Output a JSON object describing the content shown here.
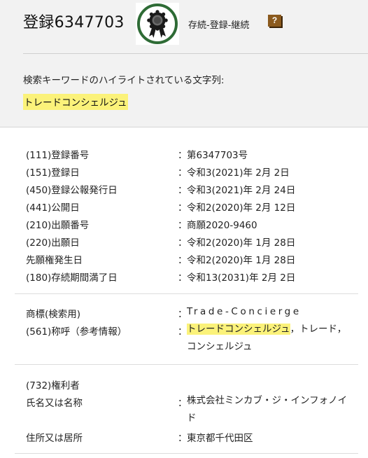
{
  "header": {
    "registration_title": "登録6347703",
    "status": "存続-登録-継続",
    "help_label": "?",
    "badge_icon": "award-ribbon-icon",
    "keyword_label": "検索キーワードのハイライトされている文字列:",
    "keyword": "トレードコンシェルジュ"
  },
  "colon": "：",
  "bibliographic": [
    {
      "label": "(111)登録番号",
      "value": "第6347703号"
    },
    {
      "label": "(151)登録日",
      "value": "令和3(2021)年 2月 2日"
    },
    {
      "label": "(450)登録公報発行日",
      "value": "令和3(2021)年 2月 24日"
    },
    {
      "label": "(441)公開日",
      "value": "令和2(2020)年 2月 12日"
    },
    {
      "label": "(210)出願番号",
      "value": "商願2020-9460"
    },
    {
      "label": "(220)出願日",
      "value": "令和2(2020)年 1月 28日"
    },
    {
      "label": "先願権発生日",
      "value": "令和2(2020)年 1月 28日"
    },
    {
      "label": "(180)存続期間満了日",
      "value": "令和13(2031)年 2月 2日"
    }
  ],
  "trademark": {
    "search_label": "商標(検索用)",
    "search_value": "Trade-Concierge",
    "pronunciation_label": "(561)称呼（参考情報）",
    "pronunciation_highlight": "トレードコンシェルジュ",
    "pronunciation_rest": "，トレード，コンシェルジュ"
  },
  "holder": {
    "section_label": "(732)権利者",
    "name_label": "氏名又は名称",
    "name_value": "株式会社ミンカブ・ジ・インフォノイド",
    "address_label": "住所又は居所",
    "address_value": "東京都千代田区"
  },
  "colors": {
    "highlight": "#fbf27a",
    "badge_ring": "#2e6b35",
    "help_button": "#8b5a1e"
  }
}
